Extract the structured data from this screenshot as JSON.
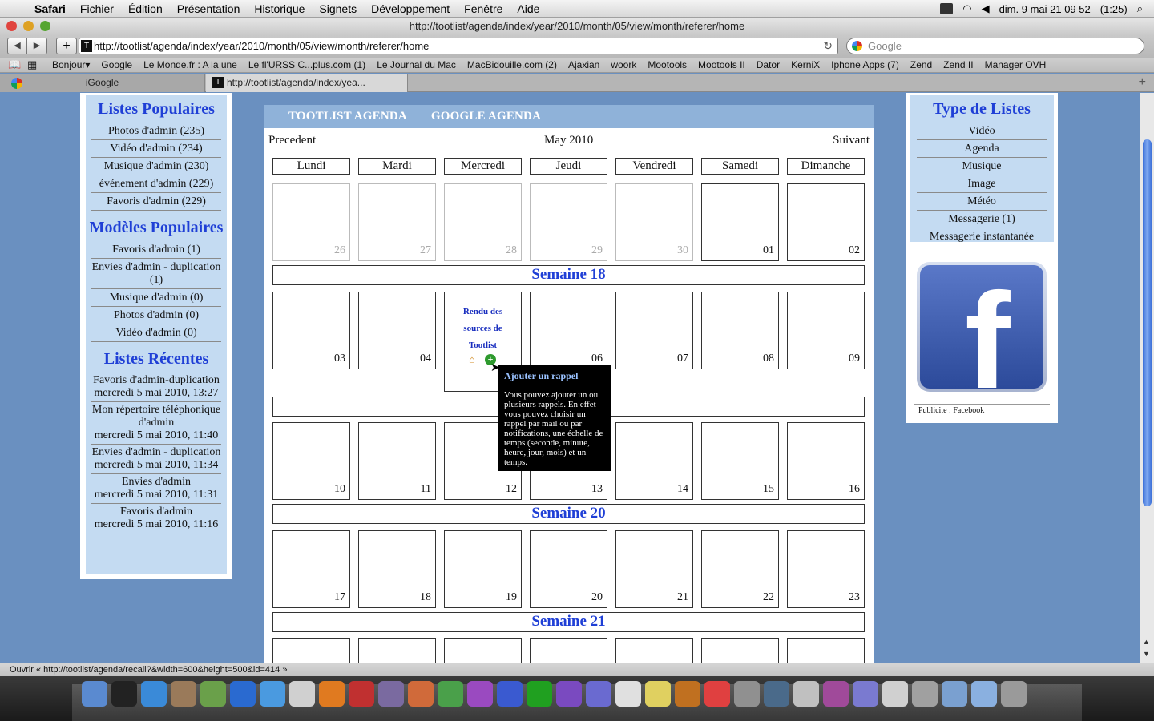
{
  "menubar": {
    "app": "Safari",
    "items": [
      "Fichier",
      "Édition",
      "Présentation",
      "Historique",
      "Signets",
      "Développement",
      "Fenêtre",
      "Aide"
    ],
    "clock": "dim. 9 mai  21 09 52",
    "battery": "(1:25)"
  },
  "window": {
    "title": "http://tootlist/agenda/index/year/2010/month/05/view/month/referer/home",
    "url": "http://tootlist/agenda/index/year/2010/month/05/view/month/referer/home",
    "search_placeholder": "Google"
  },
  "bookmarks": [
    "Bonjour▾",
    "Google",
    "Le Monde.fr : A la une",
    "Le fl'URSS C...plus.com (1)",
    "Le Journal du Mac",
    "MacBidouille.com (2)",
    "Ajaxian",
    "woork",
    "Mootools",
    "Mootools II",
    "Dator",
    "KerniX",
    "Iphone Apps (7)",
    "Zend",
    "Zend II",
    "Manager OVH"
  ],
  "tabs": {
    "inactive": "iGoogle",
    "active": "http://tootlist/agenda/index/yea..."
  },
  "left": {
    "popular_lists_title": "Listes Populaires",
    "popular_lists": [
      "Photos d'admin (235)",
      "Vidéo d'admin (234)",
      "Musique d'admin (230)",
      "événement d'admin (229)",
      "Favoris d'admin (229)"
    ],
    "popular_models_title": "Modèles Populaires",
    "popular_models": [
      "Favoris d'admin (1)",
      "Envies d'admin - duplication (1)",
      "Musique d'admin (0)",
      "Photos d'admin (0)",
      "Vidéo d'admin (0)"
    ],
    "recent_title": "Listes Récentes",
    "recent": [
      {
        "name": "Favoris d'admin-duplication",
        "date": "mercredi 5 mai 2010, 13:27"
      },
      {
        "name": "Mon répertoire téléphonique d'admin",
        "date": "mercredi 5 mai 2010, 11:40"
      },
      {
        "name": "Envies d'admin - duplication",
        "date": "mercredi 5 mai 2010, 11:34"
      },
      {
        "name": "Envies d'admin",
        "date": "mercredi 5 mai 2010, 11:31"
      },
      {
        "name": "Favoris d'admin",
        "date": "mercredi 5 mai 2010, 11:16"
      }
    ]
  },
  "calendar": {
    "header_links": [
      "TOOTLIST AGENDA",
      "GOOGLE AGENDA"
    ],
    "prev": "Precedent",
    "month": "May 2010",
    "next": "Suivant",
    "days": [
      "Lundi",
      "Mardi",
      "Mercredi",
      "Jeudi",
      "Vendredi",
      "Samedi",
      "Dimanche"
    ],
    "rows": [
      {
        "week": "",
        "cells": [
          "26",
          "27",
          "28",
          "29",
          "30",
          "01",
          "02"
        ]
      },
      {
        "week": "Semaine 18",
        "cells": [
          "03",
          "04",
          "05",
          "06",
          "07",
          "08",
          "09"
        ]
      },
      {
        "week": "",
        "cells": [
          "10",
          "11",
          "12",
          "13",
          "14",
          "15",
          "16"
        ]
      },
      {
        "week": "Semaine 20",
        "cells": [
          "17",
          "18",
          "19",
          "20",
          "21",
          "22",
          "23"
        ]
      },
      {
        "week": "Semaine 21",
        "cells": [
          "",
          "",
          "",
          "",
          "",
          "",
          ""
        ]
      }
    ],
    "event": {
      "line1": "Rendu des",
      "line2": "sources de",
      "line3": "Tootlist"
    },
    "tooltip": {
      "title": "Ajouter un rappel",
      "body": "Vous pouvez ajouter un ou plusieurs rappels. En effet vous pouvez choisir un rappel par mail ou par notifications, une échelle de temps (seconde, minute, heure, jour, mois) et un temps."
    }
  },
  "right": {
    "title": "Type de Listes",
    "items": [
      "Vidéo",
      "Agenda",
      "Musique",
      "Image",
      "Météo",
      "Messagerie (1)",
      "Messagerie instantanée"
    ],
    "ad_label": "Publicite : Facebook"
  },
  "statusbar": "Ouvrir « http://tootlist/agenda/recall?&width=600&height=500&id=414 »",
  "colors": {
    "accent": "#1f3fd6",
    "page_bg": "#6a90c0",
    "sidebar_bg": "#c4dbf2",
    "header_bg": "#8fb2d9"
  }
}
